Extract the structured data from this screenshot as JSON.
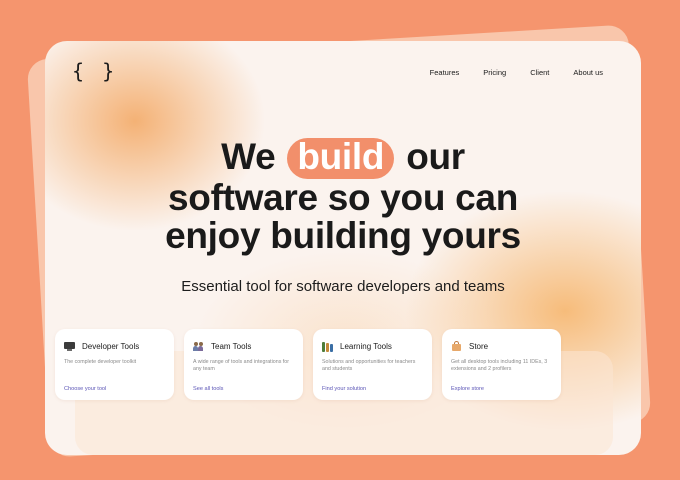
{
  "logo": "{ }",
  "nav": {
    "features": "Features",
    "pricing": "Pricing",
    "client": "Client",
    "about": "About us"
  },
  "hero": {
    "line1_before": "We",
    "line1_highlight": "build",
    "line1_after": "our",
    "line2": "software so you can",
    "line3": "enjoy building yours"
  },
  "subtitle": "Essential tool for software developers and teams",
  "cards": [
    {
      "icon": "monitor-icon",
      "title": "Developer Tools",
      "description": "The complete developer toolkit",
      "link": "Choose your tool"
    },
    {
      "icon": "people-icon",
      "title": "Team Tools",
      "description": "A wide range of tools and integrations for any team",
      "link": "See all tools"
    },
    {
      "icon": "books-icon",
      "title": "Learning Tools",
      "description": "Solutions and opportunities for teachers and students",
      "link": "Find your solution"
    },
    {
      "icon": "store-icon",
      "title": "Store",
      "description": "Get all desktop tools including 11 IDEs, 3 extensions and 2 profilers",
      "link": "Explore store"
    }
  ],
  "colors": {
    "background": "#f5956e",
    "accent": "#f28f6b",
    "link": "#5b55b6",
    "text": "#1a1a1a"
  }
}
